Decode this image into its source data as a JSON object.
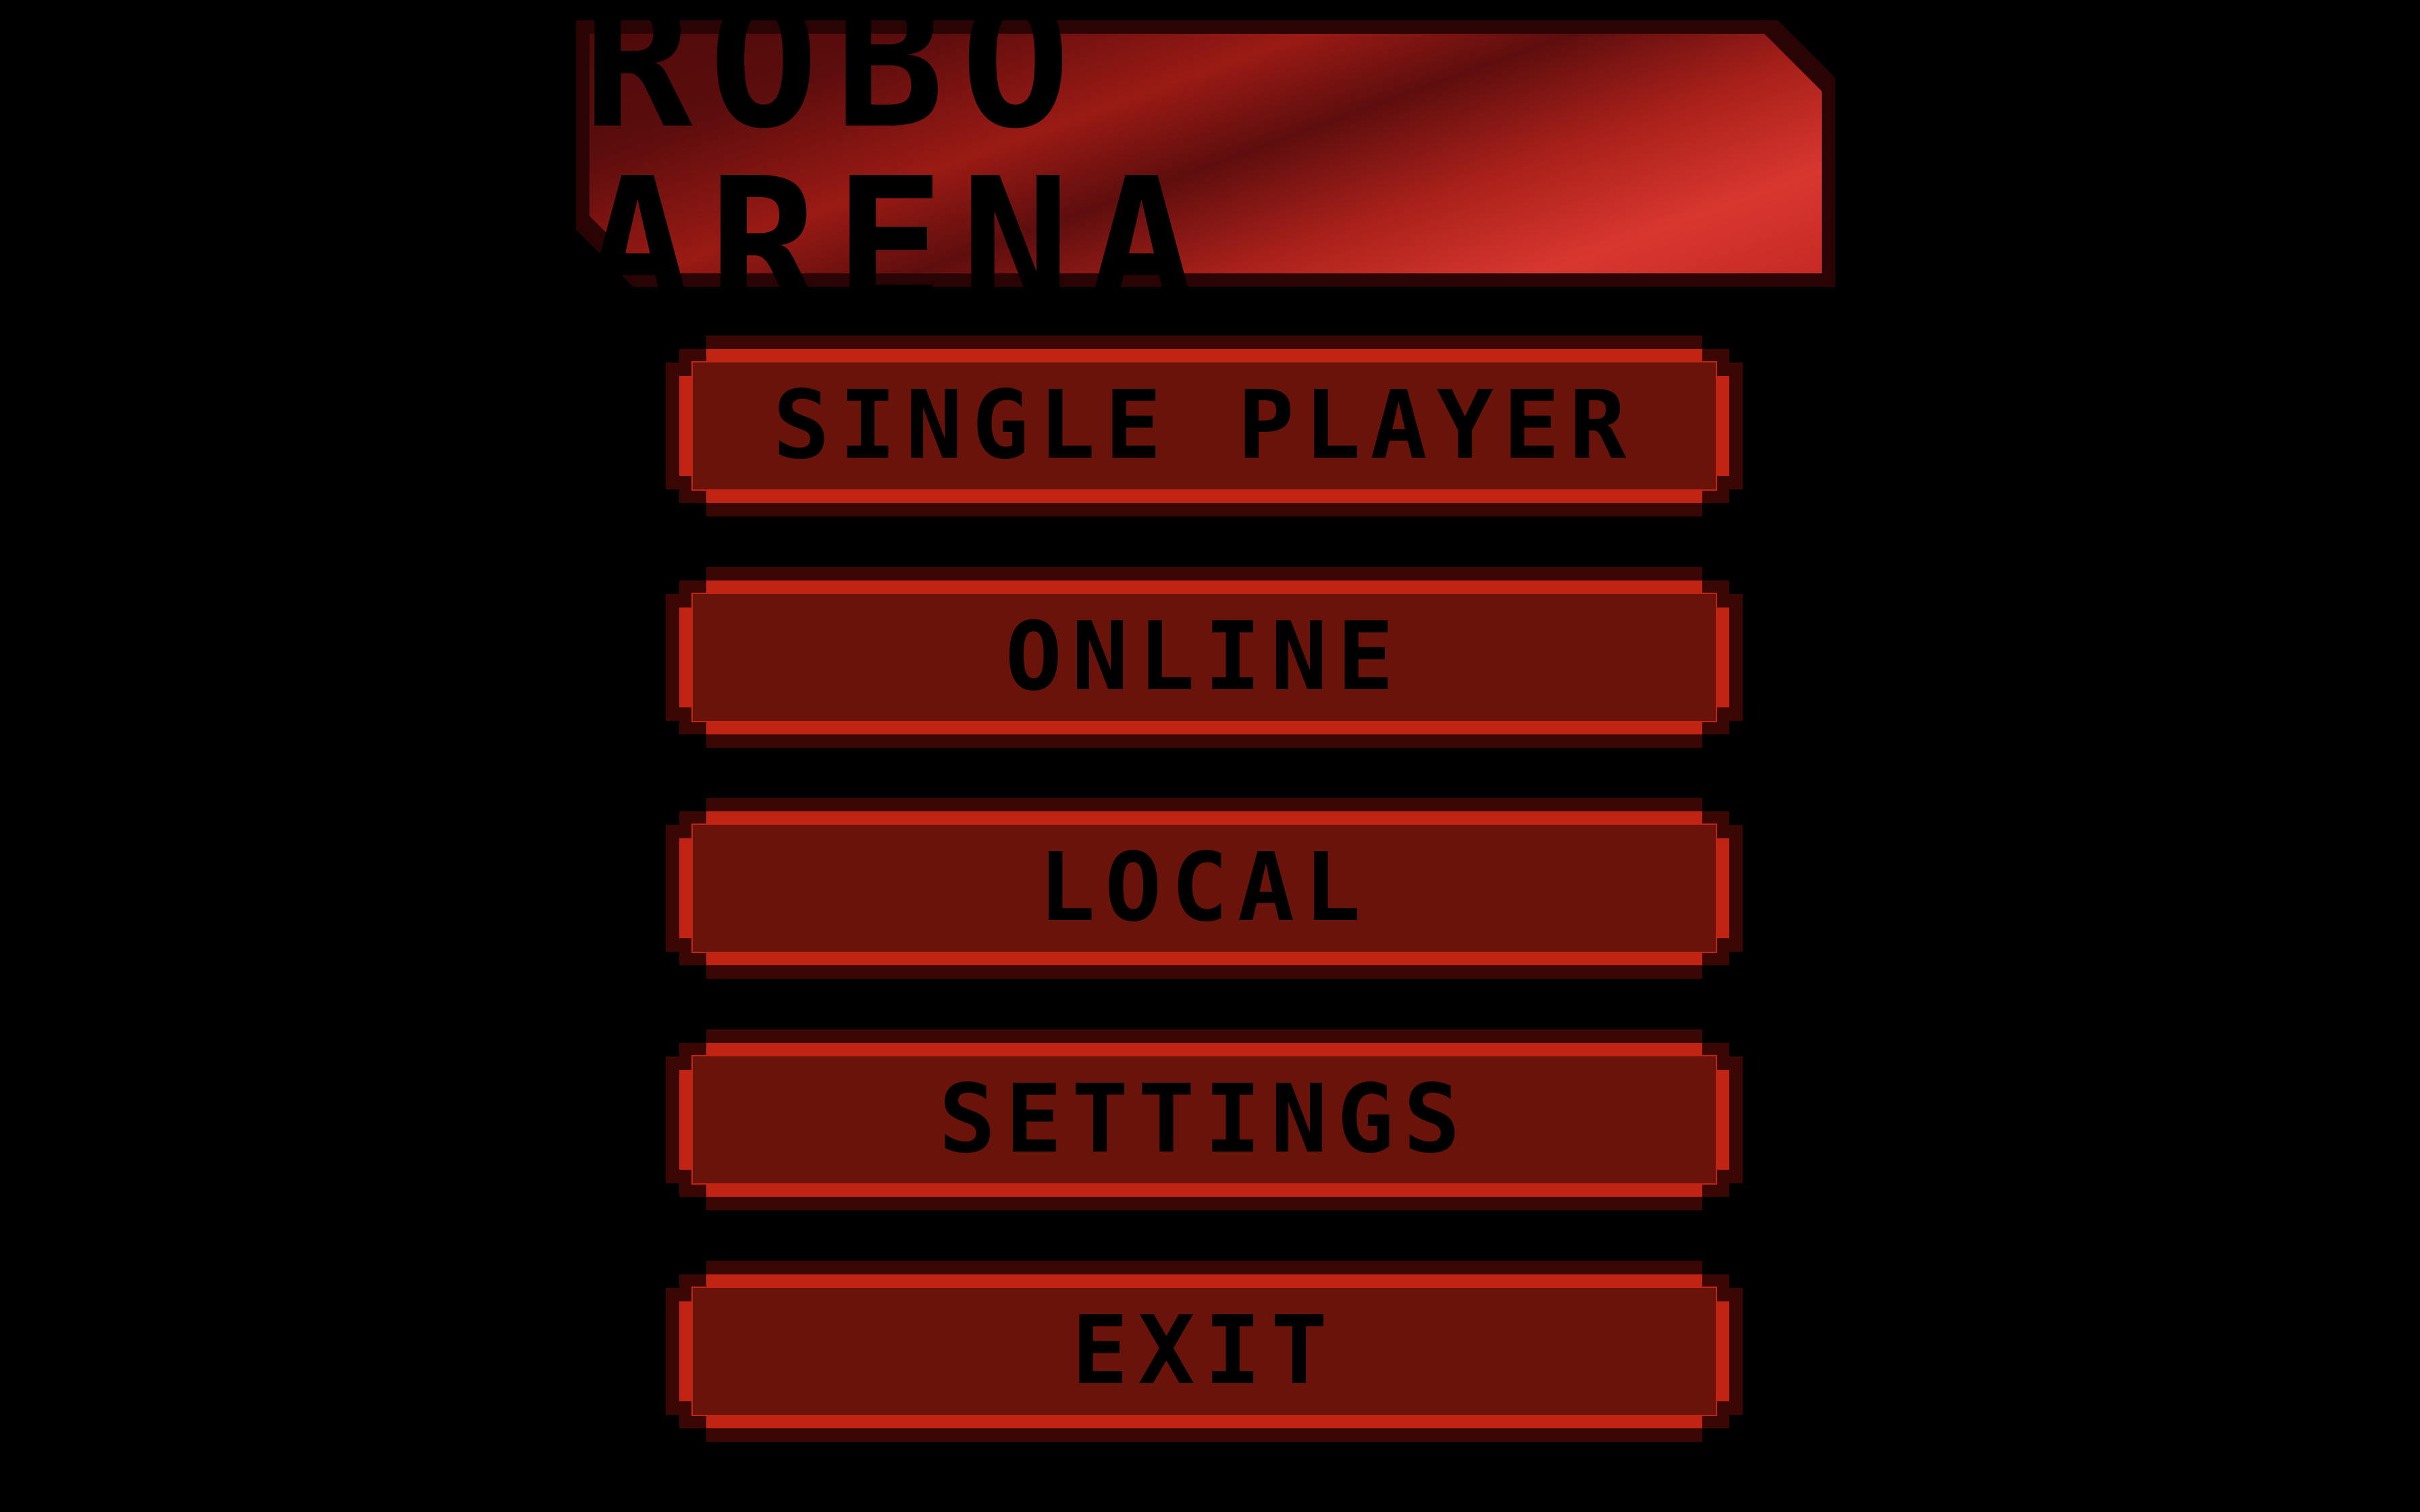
{
  "title": "ROBO ARENA",
  "menu": {
    "single_player": "SINGLE PLAYER",
    "online": "ONLINE",
    "local": "LOCAL",
    "settings": "SETTINGS",
    "exit": "EXIT"
  },
  "colors": {
    "background": "#000000",
    "button_face": "#69130b",
    "button_rim": "#c22414",
    "title_highlight": "#d8372f",
    "text": "#000000"
  }
}
